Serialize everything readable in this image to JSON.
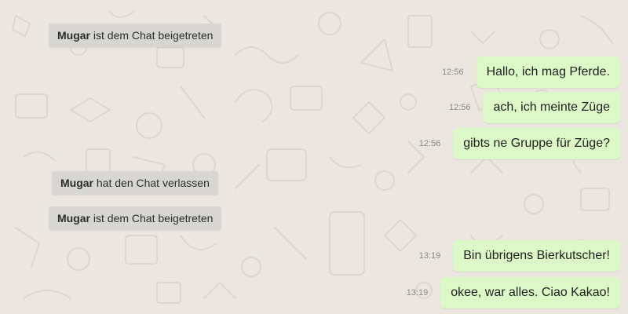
{
  "colors": {
    "chat_background": "#ebe6e0",
    "system_bubble": "#d8d6d3",
    "outgoing_bubble": "#dcf8c6",
    "timestamp": "#8e8a85"
  },
  "icons": [
    "doodle-wallpaper-icon"
  ],
  "system_messages": [
    {
      "user": "Mugar",
      "text": "ist dem Chat beigetreten"
    },
    {
      "user": "Mugar",
      "text": "hat den Chat verlassen"
    },
    {
      "user": "Mugar",
      "text": "ist dem Chat beigetreten"
    }
  ],
  "messages": [
    {
      "time": "12:56",
      "text": "Hallo, ich mag Pferde."
    },
    {
      "time": "12:56",
      "text": "ach, ich meinte Züge"
    },
    {
      "time": "12:56",
      "text": "gibts ne Gruppe für Züge?"
    },
    {
      "time": "13:19",
      "text": "Bin übrigens Bierkutscher!"
    },
    {
      "time": "13:19",
      "text": "okee, war alles. Ciao Kakao!"
    }
  ]
}
